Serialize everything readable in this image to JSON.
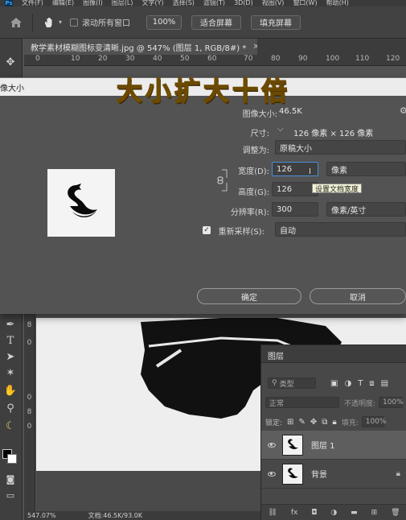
{
  "menubar": {
    "items": [
      "文件(F)",
      "编辑(E)",
      "图像(I)",
      "图层(L)",
      "文字(Y)",
      "选择(S)",
      "滤镜(T)",
      "3D(D)",
      "视图(V)",
      "窗口(W)",
      "帮助(H)"
    ]
  },
  "optionsbar": {
    "scroll_all_label": "滚动所有窗口",
    "zoom_value": "100%",
    "fit_screen": "适合屏幕",
    "fill_screen": "填充屏幕"
  },
  "document": {
    "tab_title": "教学素材模糊图标变清晰.jpg @ 547% (图层 1, RGB/8#) *",
    "ruler_h": [
      "0",
      "10",
      "20",
      "30",
      "40",
      "50",
      "60",
      "70",
      "80",
      "90",
      "100",
      "110",
      "120"
    ],
    "ruler_v": [
      "8",
      "0",
      "0",
      "8",
      "0"
    ],
    "status_zoom": "547.07%",
    "status_doc": "文档:46.5K/93.0K"
  },
  "overlay": {
    "caption": "大小扩大十倍"
  },
  "dialog": {
    "title": "像大小",
    "image_size_label": "图像大小:",
    "image_size_value": "46.5K",
    "dimensions_label": "尺寸:",
    "dimensions_value": "126 像素  ×  126 像素",
    "fit_to_label": "调整为:",
    "fit_to_value": "原稿大小",
    "width_label": "宽度(D):",
    "width_value": "126",
    "width_unit": "像素",
    "height_label": "高度(G):",
    "height_value": "126",
    "resolution_label": "分辨率(R):",
    "resolution_value": "300",
    "resolution_unit": "像素/英寸",
    "resample_label": "重新采样(S):",
    "resample_value": "自动",
    "tooltip": "设置文档宽度",
    "ok": "确定",
    "cancel": "取消"
  },
  "layers_panel": {
    "tab": "图层",
    "kind_placeholder": "类型",
    "blend_mode": "正常",
    "opacity_label": "不透明度:",
    "opacity_value": "100%",
    "lock_label": "锁定:",
    "fill_label": "填充:",
    "fill_value": "100%",
    "layers": [
      {
        "name": "图层 1",
        "selected": true
      },
      {
        "name": "背景",
        "selected": false
      }
    ],
    "footer_fx": "fx"
  },
  "colors": {
    "accent_blue": "#4a8fd8",
    "caption_yellow": "#f6e65a"
  }
}
